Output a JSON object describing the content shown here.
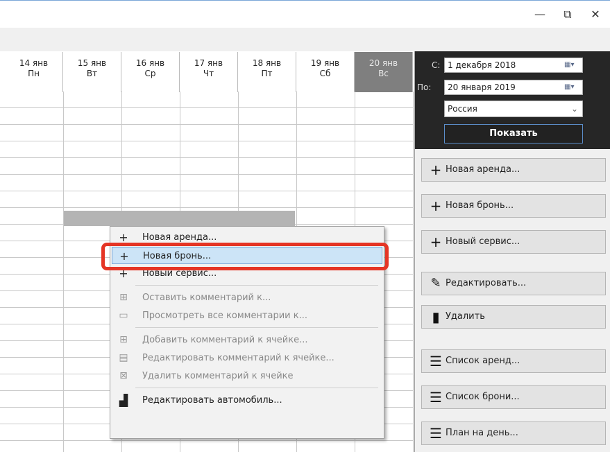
{
  "window_controls": {
    "minimize": "—",
    "maximize": "⧉",
    "close": "✕"
  },
  "grid": {
    "days": [
      {
        "date": "14 янв",
        "dow": "Пн",
        "today": false
      },
      {
        "date": "15 янв",
        "dow": "Вт",
        "today": false
      },
      {
        "date": "16 янв",
        "dow": "Ср",
        "today": false
      },
      {
        "date": "17 янв",
        "dow": "Чт",
        "today": false
      },
      {
        "date": "18 янв",
        "dow": "Пт",
        "today": false
      },
      {
        "date": "19 янв",
        "dow": "Сб",
        "today": false
      },
      {
        "date": "20 янв",
        "dow": "Вс",
        "today": true
      }
    ]
  },
  "filter": {
    "from_label": "С:",
    "from_value": "1 декабря 2018",
    "to_label": "По:",
    "to_value": "20 января 2019",
    "country": "Россия",
    "show_button": "Показать"
  },
  "actions": [
    {
      "label": "Новая аренда...",
      "icon": "plus-icon"
    },
    {
      "label": "Новая бронь...",
      "icon": "plus-icon"
    },
    {
      "label": "Новый сервис...",
      "icon": "plus-icon"
    },
    {
      "label": "Редактировать...",
      "icon": "pencil-icon"
    },
    {
      "label": "Удалить",
      "icon": "trash-icon"
    },
    {
      "label": "Список аренд...",
      "icon": "list-icon"
    },
    {
      "label": "Список брони...",
      "icon": "list-icon"
    },
    {
      "label": "План на день...",
      "icon": "list-icon"
    }
  ],
  "context_menu": {
    "items": [
      {
        "label": "Новая аренда...",
        "icon": "plus-icon",
        "enabled": true
      },
      {
        "label": "Новая бронь...",
        "icon": "plus-icon",
        "enabled": true,
        "highlighted": true
      },
      {
        "label": "Новый сервис...",
        "icon": "plus-icon",
        "enabled": true
      },
      {
        "label": "Оставить комментарий к...",
        "icon": "comment-add-icon",
        "enabled": false
      },
      {
        "label": "Просмотреть все комментарии к...",
        "icon": "comments-icon",
        "enabled": false
      },
      {
        "label": "Добавить комментарий к ячейке...",
        "icon": "comment-add-icon",
        "enabled": false
      },
      {
        "label": "Редактировать комментарий к ячейке...",
        "icon": "comment-edit-icon",
        "enabled": false
      },
      {
        "label": "Удалить комментарий к ячейке",
        "icon": "comment-delete-icon",
        "enabled": false
      },
      {
        "label": "Редактировать автомобиль...",
        "icon": "car-icon",
        "enabled": true
      }
    ]
  },
  "colors": {
    "highlight_border": "#e53525",
    "today_header": "#7f7f7f",
    "panel_dark": "#262626"
  }
}
